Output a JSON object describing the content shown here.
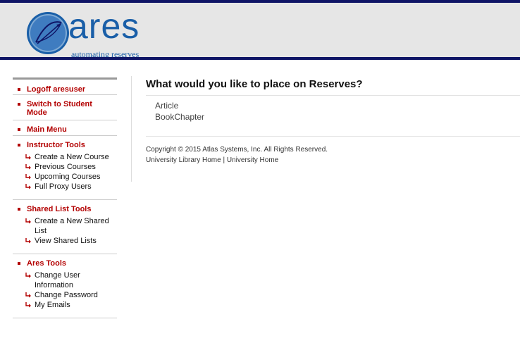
{
  "header": {
    "logo_text": "ares",
    "logo_tagline": "automating reserves"
  },
  "sidebar": {
    "logoff": "Logoff aresuser",
    "switch_mode": "Switch to Student Mode",
    "main_menu": "Main Menu",
    "instructor": {
      "title": "Instructor Tools",
      "items": [
        "Create a New Course",
        "Previous Courses",
        "Upcoming Courses",
        "Full Proxy Users"
      ]
    },
    "shared": {
      "title": "Shared List Tools",
      "items": [
        "Create a New Shared List",
        "View Shared Lists"
      ]
    },
    "ares": {
      "title": "Ares Tools",
      "items": [
        "Change User Information",
        "Change Password",
        "My Emails"
      ]
    }
  },
  "main": {
    "title": "What would you like to place on Reserves?",
    "options": [
      "Article",
      "BookChapter"
    ],
    "copyright": "Copyright © 2015 Atlas Systems, Inc. All Rights Reserved.",
    "footer_links": [
      "University Library Home",
      "University Home"
    ],
    "footer_separator": "|"
  },
  "colors": {
    "brand_navy": "#0f1566",
    "link_red": "#b30000",
    "logo_blue": "#1a5fa8"
  }
}
